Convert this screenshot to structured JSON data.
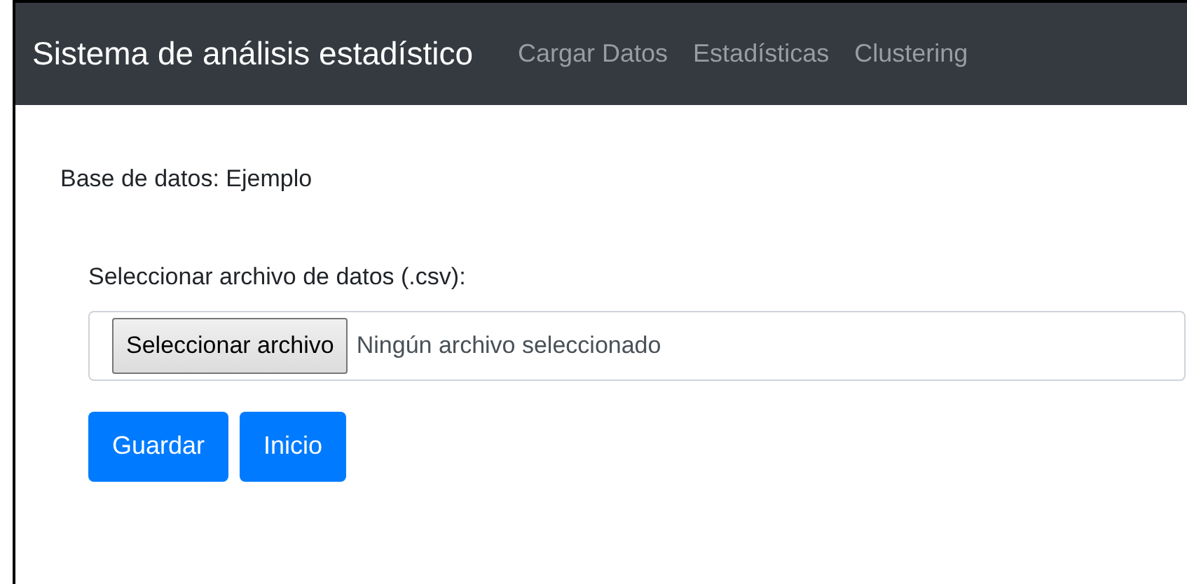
{
  "navbar": {
    "brand": "Sistema de análisis estadístico",
    "links": [
      {
        "label": "Cargar Datos"
      },
      {
        "label": "Estadísticas"
      },
      {
        "label": "Clustering"
      }
    ]
  },
  "database_label": "Base de datos: Ejemplo",
  "file_field": {
    "label": "Seleccionar archivo de datos (.csv):",
    "button": "Seleccionar archivo",
    "status": "Ningún archivo seleccionado"
  },
  "buttons": [
    {
      "label": "Guardar"
    },
    {
      "label": "Inicio"
    }
  ]
}
